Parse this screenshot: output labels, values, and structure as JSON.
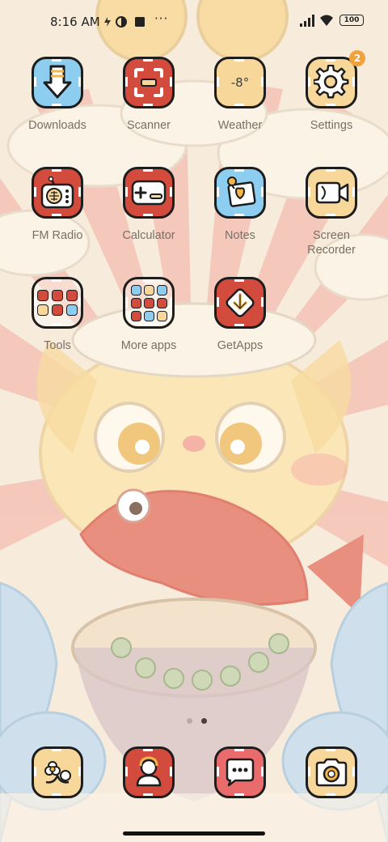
{
  "status_bar": {
    "time": "8:16 AM",
    "more": "···",
    "battery": "100"
  },
  "apps": [
    {
      "id": "downloads",
      "label": "Downloads",
      "icon": "download-arrow-icon",
      "color": "#8ccdf0"
    },
    {
      "id": "scanner",
      "label": "Scanner",
      "icon": "scanner-icon",
      "color": "#d24b3c"
    },
    {
      "id": "weather",
      "label": "Weather",
      "icon": "weather-icon",
      "color": "#f8d79a",
      "temp": "-8°"
    },
    {
      "id": "settings",
      "label": "Settings",
      "icon": "gear-icon",
      "color": "#f8d79a",
      "badge": "2"
    },
    {
      "id": "fm-radio",
      "label": "FM Radio",
      "icon": "radio-icon",
      "color": "#d24b3c"
    },
    {
      "id": "calculator",
      "label": "Calculator",
      "icon": "calculator-icon",
      "color": "#d24b3c"
    },
    {
      "id": "notes",
      "label": "Notes",
      "icon": "notes-icon",
      "color": "#8ccdf0"
    },
    {
      "id": "screen-recorder",
      "label": "Screen\nRecorder",
      "icon": "video-camera-icon",
      "color": "#f8d79a"
    },
    {
      "id": "tools",
      "label": "Tools",
      "icon": "folder-icon",
      "color": "transparent"
    },
    {
      "id": "more-apps",
      "label": "More apps",
      "icon": "folder-icon",
      "color": "transparent"
    },
    {
      "id": "getapps",
      "label": "GetApps",
      "icon": "getapps-icon",
      "color": "#d24b3c"
    }
  ],
  "dock": [
    {
      "id": "gallery",
      "icon": "flower-icon",
      "color": "#f8d79a"
    },
    {
      "id": "contacts",
      "icon": "contact-icon",
      "color": "#d24b3c"
    },
    {
      "id": "messages",
      "icon": "chat-bubble-icon",
      "color": "#e96b6b"
    },
    {
      "id": "camera",
      "icon": "camera-icon",
      "color": "#f8d79a"
    }
  ],
  "page_indicator": {
    "pages": 2,
    "current": 2
  },
  "colors": {
    "label": "#7a6f66",
    "outline": "#1d1d1d",
    "wallpaper_base": "#f6ead8",
    "ray_red": "#f3bfb4",
    "badge": "#f2a23d"
  }
}
